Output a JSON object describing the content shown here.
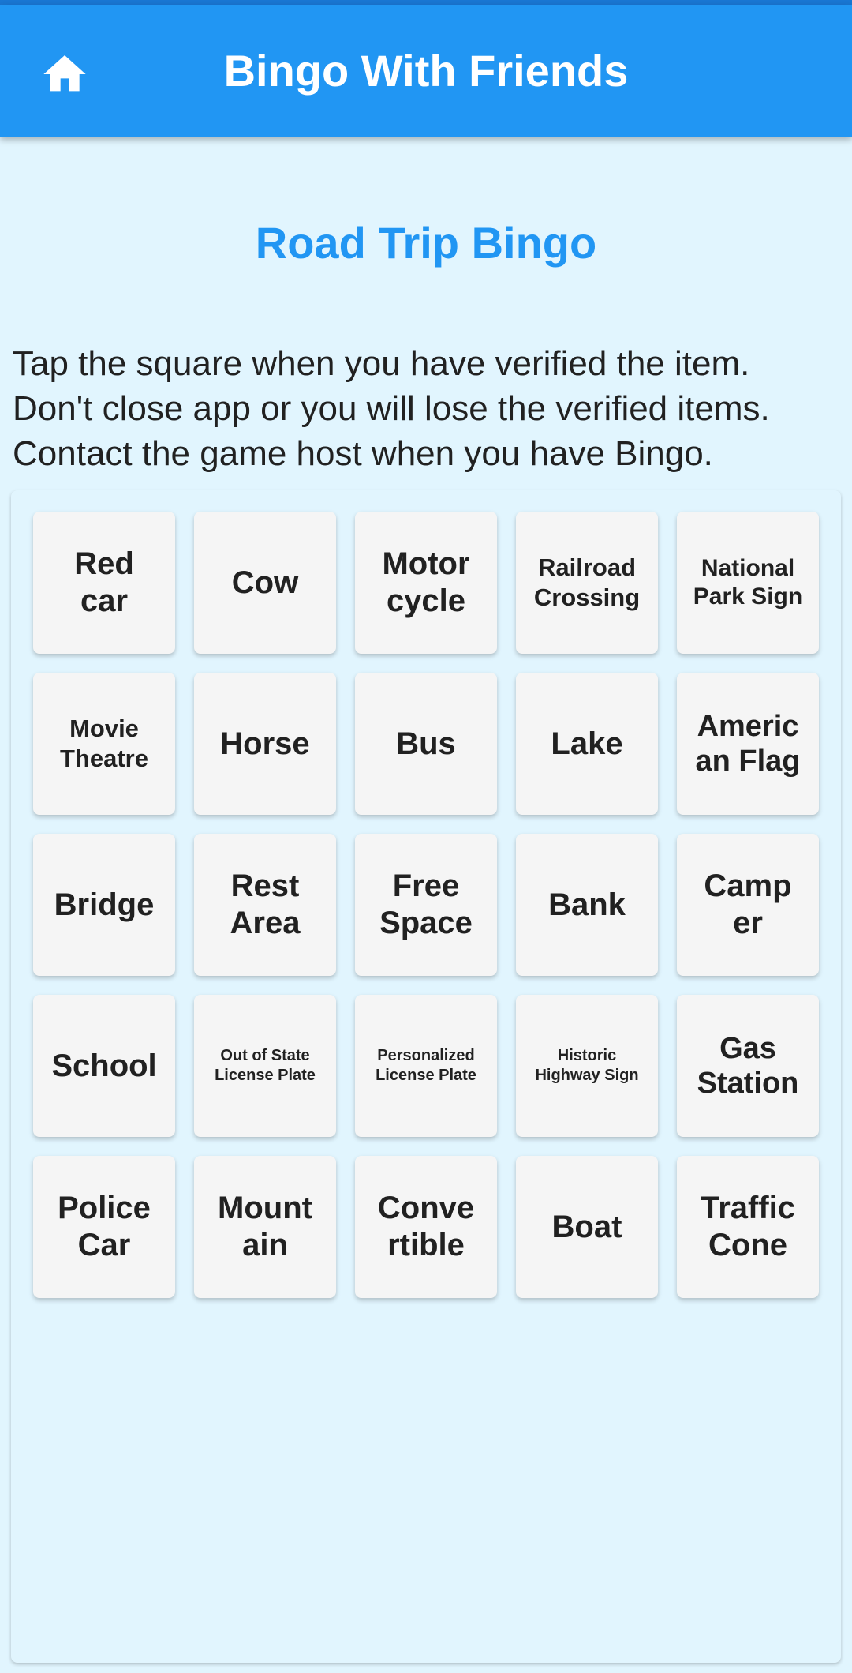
{
  "app_bar": {
    "title": "Bingo With Friends",
    "home_icon": "home-icon"
  },
  "game": {
    "title": "Road Trip Bingo",
    "instructions": [
      "Tap the square when you have verified the item.",
      "Don't close app or you will lose the verified items.",
      "Contact the game host when you have Bingo."
    ]
  },
  "board": {
    "cells": [
      [
        "Red",
        "car"
      ],
      [
        "Cow"
      ],
      [
        "Motor",
        "cycle"
      ],
      [
        "Railroad",
        "Crossing"
      ],
      [
        "National",
        "Park Sign"
      ],
      [
        "Movie",
        "Theatre"
      ],
      [
        "Horse"
      ],
      [
        "Bus"
      ],
      [
        "Lake"
      ],
      [
        "Americ",
        "an Flag"
      ],
      [
        "Bridge"
      ],
      [
        "Rest",
        "Area"
      ],
      [
        "Free",
        "Space"
      ],
      [
        "Bank"
      ],
      [
        "Camp",
        "er"
      ],
      [
        "School"
      ],
      [
        "Out of State",
        "License Plate"
      ],
      [
        "Personalized",
        "License Plate"
      ],
      [
        "Historic",
        "Highway Sign"
      ],
      [
        "Gas",
        "Station"
      ],
      [
        "Police",
        "Car"
      ],
      [
        "Mount",
        "ain"
      ],
      [
        "Conve",
        "rtible"
      ],
      [
        "Boat"
      ],
      [
        "Traffic",
        "Cone"
      ]
    ]
  },
  "colors": {
    "app_bar": "#2196f3",
    "title_accent": "#2196f3",
    "background": "#e1f5fe",
    "cell": "#f5f5f5",
    "text": "#212121"
  }
}
